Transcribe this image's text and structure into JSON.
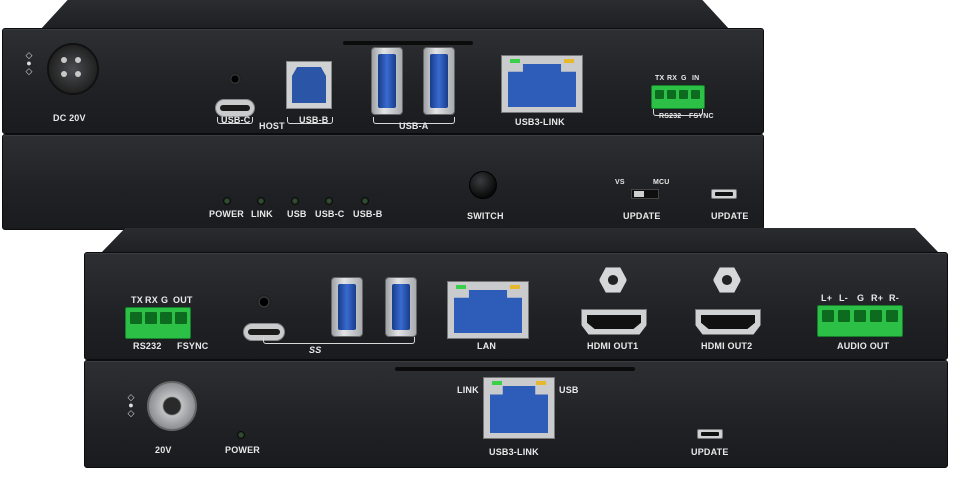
{
  "transmitter_rear": {
    "dc_label": "DC 20V",
    "usbc_label": "USB-C",
    "host_label": "HOST",
    "usbb_label": "USB-B",
    "usba_label": "USB-A",
    "link_label": "USB3-LINK",
    "terminal_pins": [
      "TX",
      "RX",
      "G",
      "IN"
    ],
    "terminal_caption_left": "RS232",
    "terminal_caption_right": "FSYNC"
  },
  "transmitter_front": {
    "leds": [
      "POWER",
      "LINK",
      "USB",
      "USB-C",
      "USB-B"
    ],
    "switch_label": "SWITCH",
    "slide_left": "VS",
    "slide_right": "MCU",
    "update_switch_label": "UPDATE",
    "update_port_label": "UPDATE"
  },
  "receiver_rear": {
    "terminal_pins": [
      "TX",
      "RX",
      "G",
      "OUT"
    ],
    "terminal_caption_left": "RS232",
    "terminal_caption_right": "FSYNC",
    "usb_logo": "SS",
    "lan_label": "LAN",
    "hdmi1_label": "HDMI OUT1",
    "hdmi2_label": "HDMI OUT2",
    "audio_pins": [
      "L+",
      "L-",
      "G",
      "R+",
      "R-"
    ],
    "audio_label": "AUDIO OUT"
  },
  "receiver_front": {
    "dc_label": "20V",
    "power_label": "POWER",
    "link_left": "LINK",
    "link_right": "USB",
    "link_label": "USB3-LINK",
    "update_label": "UPDATE"
  },
  "colors": {
    "chassis": "#1f2124",
    "terminal_green": "#2dc046",
    "port_blue": "#2d5db8",
    "label": "#e9e9e9"
  }
}
